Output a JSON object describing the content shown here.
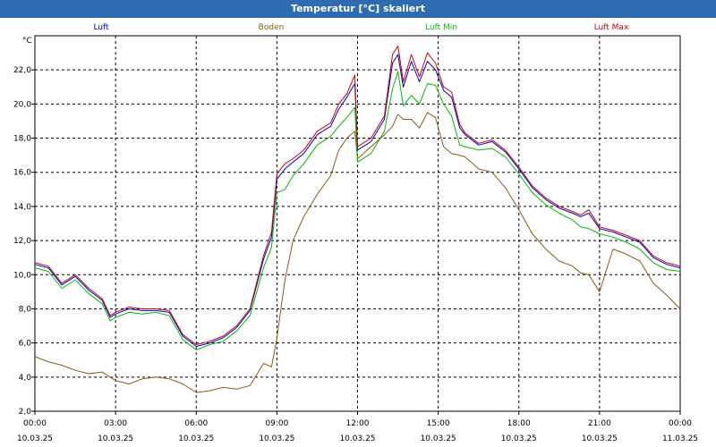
{
  "window": {
    "title": "Temperatur [°C] skaliert"
  },
  "chart_data": {
    "type": "line",
    "title": "Temperatur [°C] skaliert",
    "ylabel": "°C",
    "xlabel": "",
    "ylim": [
      2.0,
      24.0
    ],
    "y_ticks": [
      "2,0",
      "4,0",
      "6,0",
      "8,0",
      "10,0",
      "12,0",
      "14,0",
      "16,0",
      "18,0",
      "20,0",
      "22,0"
    ],
    "x_ticks": [
      {
        "time": "00:00",
        "date": "10.03.25"
      },
      {
        "time": "03:00",
        "date": "10.03.25"
      },
      {
        "time": "06:00",
        "date": "10.03.25"
      },
      {
        "time": "09:00",
        "date": "10.03.25"
      },
      {
        "time": "12:00",
        "date": "10.03.25"
      },
      {
        "time": "15:00",
        "date": "10.03.25"
      },
      {
        "time": "18:00",
        "date": "10.03.25"
      },
      {
        "time": "21:00",
        "date": "10.03.25"
      },
      {
        "time": "00:00",
        "date": "11.03.25"
      }
    ],
    "grid": true,
    "legend_position": "top",
    "x_hours": [
      0,
      0.5,
      1,
      1.5,
      2,
      2.5,
      2.8,
      3,
      3.5,
      4,
      4.5,
      5,
      5.5,
      6,
      6.5,
      7,
      7.5,
      8,
      8.5,
      8.8,
      9,
      9.3,
      9.6,
      10,
      10.5,
      11,
      11.3,
      11.6,
      11.9,
      12,
      12.5,
      13,
      13.3,
      13.5,
      13.7,
      14,
      14.3,
      14.6,
      14.9,
      15.2,
      15.5,
      15.8,
      16,
      16.5,
      17,
      17.5,
      18,
      18.5,
      19,
      19.5,
      20,
      20.3,
      20.6,
      21,
      21.5,
      22,
      22.5,
      23,
      23.5,
      24
    ],
    "series": [
      {
        "name": "Luft",
        "color": "#0000cc",
        "values": [
          10.6,
          10.4,
          9.4,
          9.9,
          9.1,
          8.5,
          7.5,
          7.7,
          8.0,
          7.9,
          7.9,
          7.8,
          6.4,
          5.8,
          6.0,
          6.3,
          6.9,
          7.9,
          10.9,
          12.2,
          15.6,
          16.2,
          16.6,
          17.1,
          18.2,
          18.7,
          19.7,
          20.4,
          21.2,
          17.3,
          17.8,
          19.1,
          22.4,
          22.9,
          21.0,
          22.5,
          21.3,
          22.5,
          22.0,
          20.8,
          20.4,
          18.6,
          18.2,
          17.6,
          17.8,
          17.2,
          16.2,
          15.1,
          14.4,
          13.9,
          13.6,
          13.4,
          13.6,
          12.7,
          12.5,
          12.2,
          11.9,
          11.0,
          10.6,
          10.4
        ]
      },
      {
        "name": "Boden",
        "color": "#8b5a10",
        "values": [
          5.2,
          4.9,
          4.7,
          4.4,
          4.2,
          4.3,
          4.0,
          3.8,
          3.6,
          3.9,
          4.0,
          3.9,
          3.6,
          3.1,
          3.2,
          3.4,
          3.3,
          3.5,
          4.8,
          4.6,
          6.3,
          9.7,
          12.0,
          13.4,
          14.7,
          15.8,
          17.3,
          18.0,
          18.4,
          16.8,
          17.5,
          18.2,
          18.7,
          19.4,
          19.1,
          19.1,
          18.6,
          19.5,
          19.2,
          17.5,
          17.1,
          17.0,
          16.9,
          16.2,
          16.0,
          15.1,
          13.8,
          12.4,
          11.5,
          10.8,
          10.5,
          10.1,
          10.0,
          9.0,
          11.5,
          11.2,
          10.8,
          9.5,
          8.8,
          8.0
        ]
      },
      {
        "name": "Luft Min",
        "color": "#00bb00",
        "values": [
          10.4,
          10.2,
          9.2,
          9.7,
          8.9,
          8.3,
          7.3,
          7.5,
          7.8,
          7.7,
          7.8,
          7.6,
          6.2,
          5.6,
          5.9,
          6.1,
          6.7,
          7.6,
          10.4,
          11.6,
          14.8,
          15.0,
          15.8,
          16.5,
          17.6,
          18.1,
          18.7,
          19.2,
          19.8,
          16.6,
          17.1,
          18.4,
          20.9,
          21.9,
          19.9,
          20.5,
          20.0,
          21.2,
          21.1,
          20.0,
          19.3,
          17.6,
          17.5,
          17.3,
          17.4,
          16.9,
          15.9,
          14.8,
          14.1,
          13.6,
          13.2,
          12.8,
          12.7,
          12.4,
          12.2,
          11.9,
          11.5,
          10.7,
          10.3,
          10.2
        ]
      },
      {
        "name": "Luft Max",
        "color": "#cc0000",
        "values": [
          10.7,
          10.5,
          9.5,
          10.0,
          9.2,
          8.6,
          7.6,
          7.8,
          8.1,
          8.0,
          8.0,
          7.9,
          6.5,
          5.9,
          6.1,
          6.4,
          7.0,
          8.0,
          11.1,
          12.5,
          15.9,
          16.5,
          16.8,
          17.3,
          18.4,
          18.9,
          20.0,
          20.6,
          21.7,
          17.5,
          18.0,
          19.3,
          22.9,
          23.4,
          21.3,
          22.9,
          21.6,
          23.0,
          22.4,
          21.0,
          20.7,
          18.8,
          18.3,
          17.7,
          17.9,
          17.3,
          16.3,
          15.2,
          14.5,
          14.0,
          13.7,
          13.5,
          13.8,
          12.8,
          12.6,
          12.3,
          12.0,
          11.1,
          10.7,
          10.5
        ]
      }
    ]
  }
}
